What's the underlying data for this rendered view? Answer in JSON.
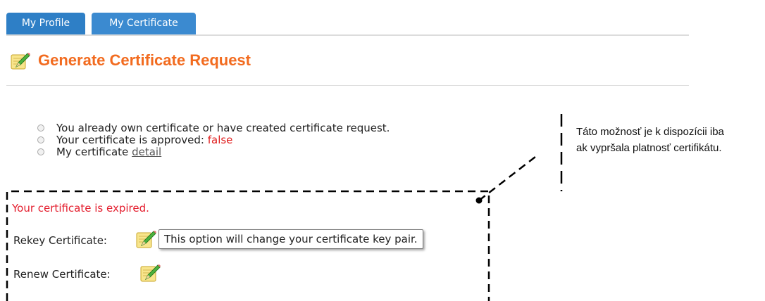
{
  "tabs": [
    {
      "label": "My Profile"
    },
    {
      "label": "My Certificate"
    }
  ],
  "page": {
    "title": "Generate Certificate Request",
    "title_icon": "pencil-edit-icon"
  },
  "info": {
    "item1": "You already own certificate or have created certificate request.",
    "item2_prefix": "Your certificate is approved:",
    "item2_value": "false",
    "item3_prefix": "My certificate",
    "item3_link": "detail"
  },
  "expired": {
    "message": "Your certificate is expired.",
    "rekey_label": "Rekey Certificate:",
    "renew_label": "Renew Certificate:",
    "tooltip": "This option will change your certificate key pair."
  },
  "annotation": {
    "line1": "Táto možnosť je k dispozícii iba",
    "line2": "ak vypršala platnosť certifikátu."
  },
  "colors": {
    "tab": "#2e7fc6",
    "title": "#f26b1f",
    "expired": "#e41e2e",
    "false_value": "#e02020"
  }
}
